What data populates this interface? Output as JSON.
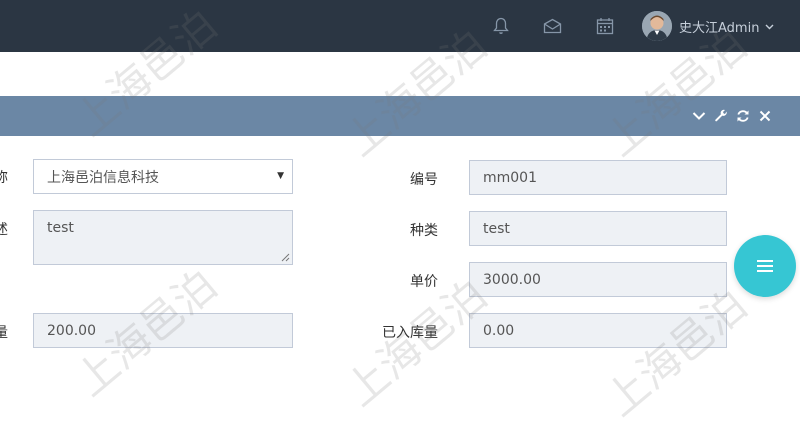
{
  "topbar": {
    "icons": [
      "bell-icon",
      "envelope-icon",
      "calendar-icon"
    ],
    "username": "史大江Admin",
    "caret": "⌄",
    "background": "#2b3643"
  },
  "portlet": {
    "header_color": "#6b87a5",
    "tools": [
      "chevron-down-icon",
      "wrench-icon",
      "refresh-icon",
      "close-icon"
    ]
  },
  "form": {
    "left": {
      "company": {
        "label_fragment": "称",
        "value": "上海邑泊信息科技"
      },
      "remark": {
        "label_fragment": "述",
        "value": "test"
      },
      "quantity": {
        "label_fragment": "量",
        "value": "200.00"
      }
    },
    "right": {
      "code": {
        "label": "编号",
        "value": "mm001"
      },
      "category": {
        "label": "种类",
        "value": "test"
      },
      "price": {
        "label": "单价",
        "value": "3000.00"
      },
      "stocked": {
        "label": "已入库量",
        "value": "0.00"
      }
    }
  },
  "fab": {
    "color": "#36c6d3",
    "icon": "menu-icon"
  },
  "watermark": {
    "text": "上海邑泊"
  }
}
